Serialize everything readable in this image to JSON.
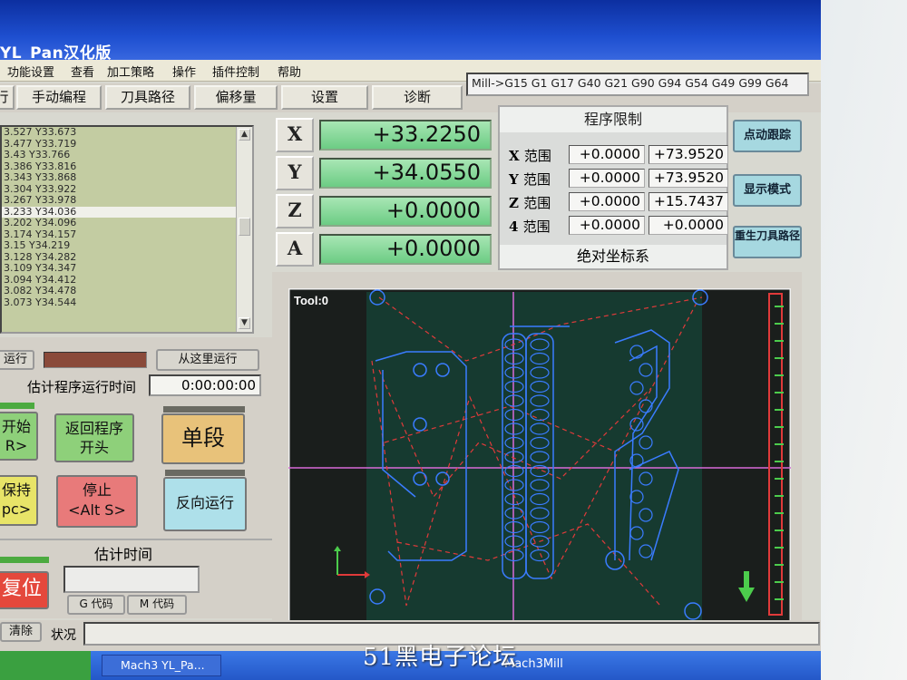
{
  "window": {
    "title": "YL_Pan汉化版"
  },
  "menu": [
    "功能设置",
    "查看",
    "加工策略",
    "操作",
    "插件控制",
    "帮助"
  ],
  "tabs": [
    "行",
    "手动编程",
    "刀具路径",
    "偏移量",
    "设置",
    "诊断"
  ],
  "modal_line": "Mill->G15  G1 G17 G40 G21 G90 G94 G54 G49 G99 G64",
  "gcode_list": [
    "3.527 Y33.673",
    "3.477 Y33.719",
    "3.43 Y33.766",
    "3.386 Y33.816",
    "3.343 Y33.868",
    "3.304 Y33.922",
    "3.267 Y33.978",
    "3.233 Y34.036",
    "3.202 Y34.096",
    "3.174 Y34.157",
    "3.15 Y34.219",
    "3.128 Y34.282",
    "3.109 Y34.347",
    "3.094 Y34.412",
    "3.082 Y34.478",
    "3.073 Y34.544"
  ],
  "gcode_selected_index": 7,
  "dro": [
    {
      "axis": "X",
      "value": "+33.2250"
    },
    {
      "axis": "Y",
      "value": "+34.0550"
    },
    {
      "axis": "Z",
      "value": "+0.0000"
    },
    {
      "axis": "A",
      "value": "+0.0000"
    }
  ],
  "limits": {
    "header": "程序限制",
    "rows": [
      {
        "axis": "X",
        "label": "范围",
        "min": "+0.0000",
        "max": "+73.9520"
      },
      {
        "axis": "Y",
        "label": "范围",
        "min": "+0.0000",
        "max": "+73.9520"
      },
      {
        "axis": "Z",
        "label": "范围",
        "min": "+0.0000",
        "max": "+15.7437"
      },
      {
        "axis": "4",
        "label": "范围",
        "min": "+0.0000",
        "max": "+0.0000"
      }
    ],
    "footer": "绝对坐标系"
  },
  "side_buttons": [
    "点动跟踪",
    "显示模式",
    "重生刀具路径"
  ],
  "controls": {
    "run_label": "运行",
    "run_from_here": "从这里运行",
    "est_run_time_label": "估计程序运行时间",
    "est_run_time_value": "0:00:00:00",
    "start_line1": "开始",
    "start_line2": "R>",
    "rewind_line1": "返回程序",
    "rewind_line2": "开头",
    "single_block": "单段",
    "hold_line1": "保持",
    "hold_line2": "pc>",
    "stop_line1": "停止",
    "stop_line2": "<Alt S>",
    "reverse_run": "反向运行",
    "est_time_label": "估计时间",
    "reset": "复位",
    "g_codes": "G 代码",
    "m_codes": "M 代码"
  },
  "toolpath": {
    "tool_label": "Tool:0"
  },
  "status": {
    "clear": "清除",
    "label": "状况"
  },
  "taskbar": {
    "item": "Mach3 YL_Pa...",
    "profile": "Mach3Mill"
  },
  "watermark": "51黑电子论坛"
}
